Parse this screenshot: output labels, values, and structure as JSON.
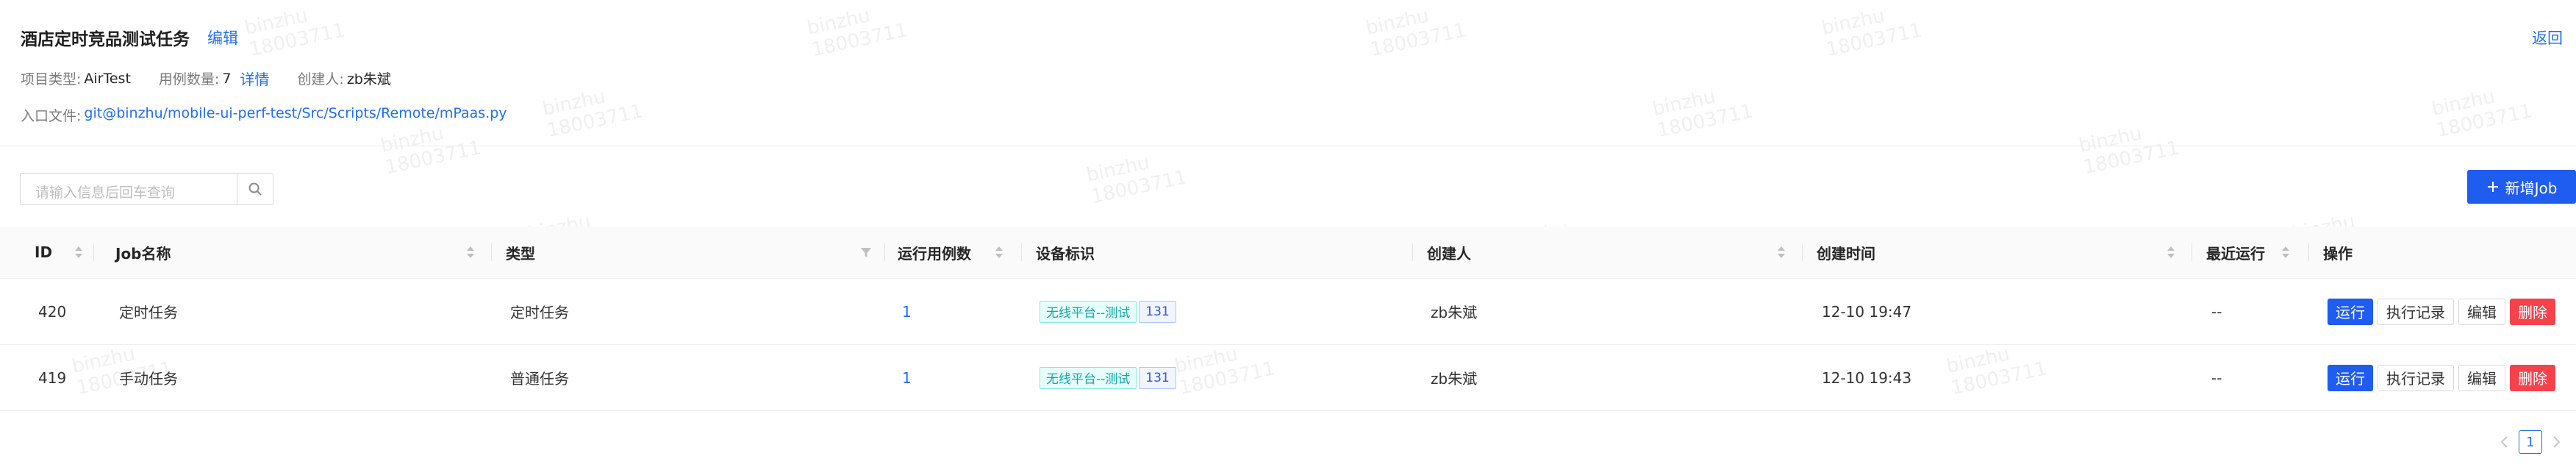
{
  "header": {
    "task_title": "酒店定时竞品测试任务",
    "edit_label": "编辑",
    "back_label": "返回",
    "project_type_label": "项目类型:",
    "project_type_value": "AirTest",
    "case_count_label": "用例数量:",
    "case_count_value": "7",
    "detail_label": "详情",
    "creator_label": "创建人:",
    "creator_value": "zb朱斌",
    "entry_label": "入口文件:",
    "entry_value": "git@binzhu/mobile-ui-perf-test/Src/Scripts/Remote/mPaas.py"
  },
  "toolbar": {
    "search_placeholder": "请输入信息后回车查询",
    "add_job_label": "新增Job"
  },
  "table": {
    "columns": [
      "ID",
      "Job名称",
      "类型",
      "运行用例数",
      "设备标识",
      "创建人",
      "创建时间",
      "最近运行",
      "操作"
    ],
    "rows": [
      {
        "id": "420",
        "name": "定时任务",
        "type": "定时任务",
        "case_count": "1",
        "device_tag": "无线平台--测试",
        "device_count": "131",
        "creator": "zb朱斌",
        "created_at": "12-10 19:47",
        "last_run": "--"
      },
      {
        "id": "419",
        "name": "手动任务",
        "type": "普通任务",
        "case_count": "1",
        "device_tag": "无线平台--测试",
        "device_count": "131",
        "creator": "zb朱斌",
        "created_at": "12-10 19:43",
        "last_run": "--"
      }
    ],
    "actions": {
      "run": "运行",
      "history": "执行记录",
      "edit": "编辑",
      "delete": "删除"
    }
  },
  "pagination": {
    "current_page": "1"
  },
  "watermark": {
    "line1": "binzhu",
    "line2": "18003711"
  },
  "colors": {
    "primary": "#1f5cf0",
    "link": "#1f6ff0",
    "danger": "#f5424b",
    "tag_green": "#13a8a8",
    "tag_blue": "#2f54eb"
  }
}
